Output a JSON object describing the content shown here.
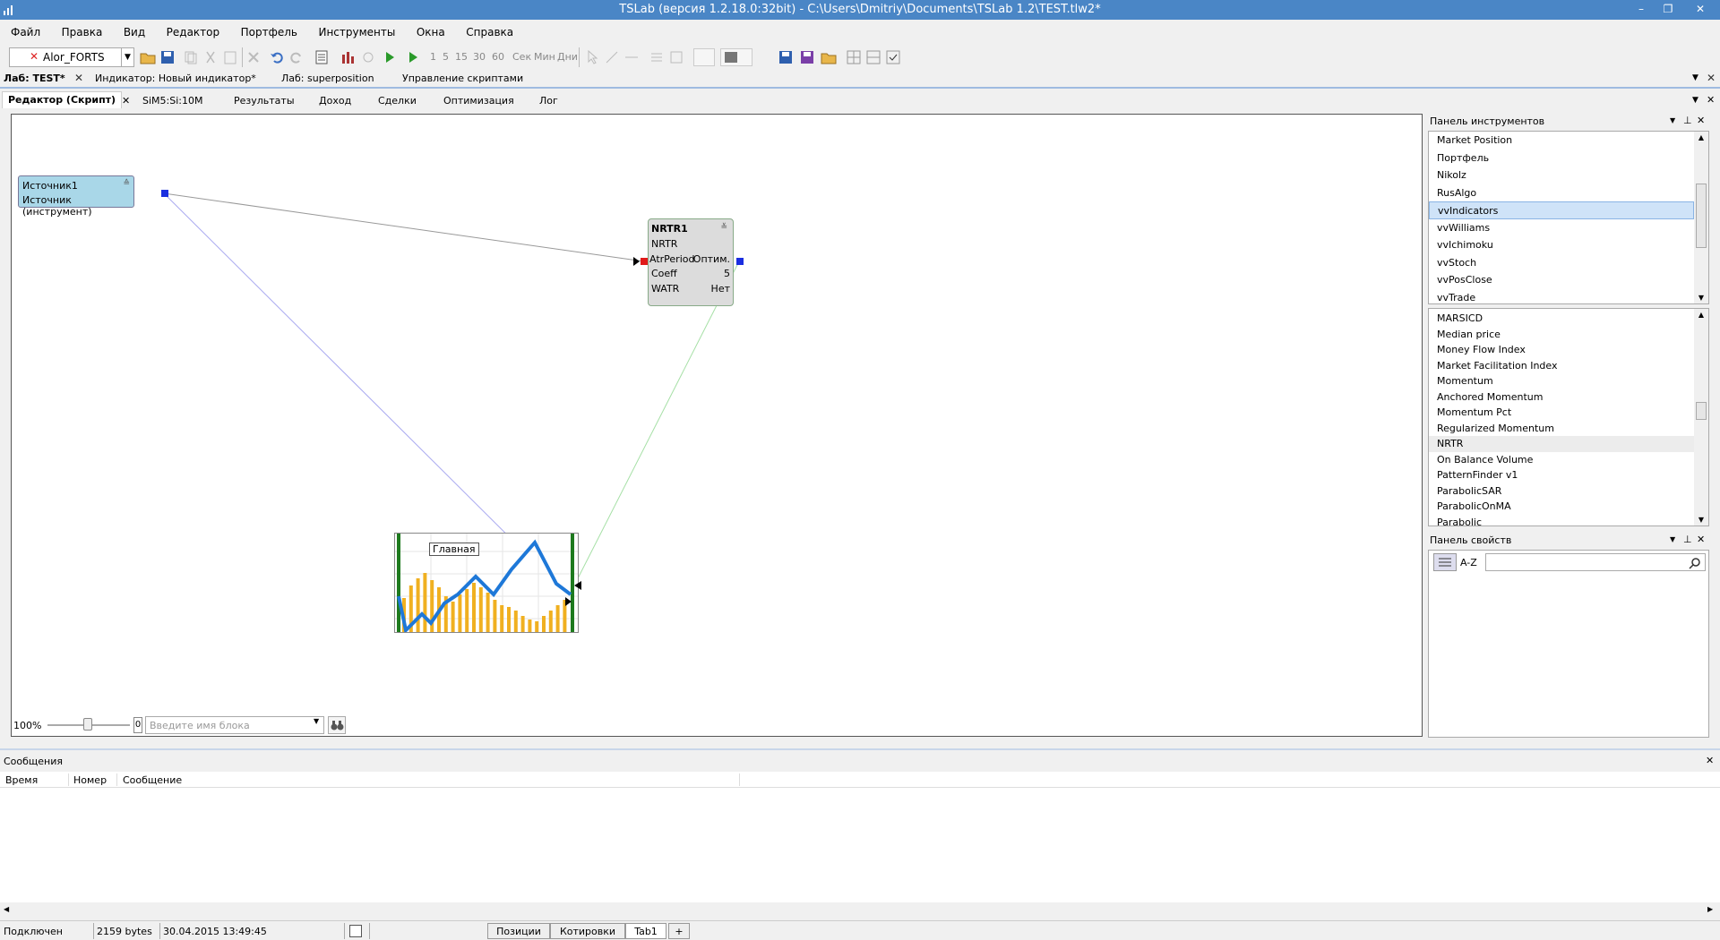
{
  "window": {
    "title": "TSLab (версия 1.2.18.0:32bit) - C:\\Users\\Dmitriy\\Documents\\TSLab 1.2\\TEST.tlw2*",
    "minimize": "–",
    "restore": "❐",
    "close": "✕"
  },
  "menu": [
    "Файл",
    "Правка",
    "Вид",
    "Редактор",
    "Портфель",
    "Инструменты",
    "Окна",
    "Справка"
  ],
  "toolbar": {
    "connection": "Alor_FORTS",
    "intervals": [
      "1",
      "5",
      "15",
      "30",
      "60",
      "Сек",
      "Мин",
      "Дни"
    ]
  },
  "lab_tabs": {
    "lab": "Лаб: TEST*",
    "indicator": "Индикатор: Новый индикатор*",
    "lab2": "Лаб: superposition",
    "scripts": "Управление скриптами"
  },
  "inner_tabs": [
    "Редактор (Скрипт)",
    "SiM5:Si:10M",
    "Результаты",
    "Доход",
    "Сделки",
    "Оптимизация",
    "Лог"
  ],
  "canvas": {
    "source_block": {
      "name": "Источник1",
      "type": "Источник (инструмент)"
    },
    "nrtr_block": {
      "name": "NRTR1",
      "type": "NRTR",
      "params": [
        {
          "name": "AtrPeriod",
          "value": "Оптим."
        },
        {
          "name": "Coeff",
          "value": "5"
        },
        {
          "name": "WATR",
          "value": "Нет"
        }
      ]
    },
    "chart_block": {
      "label": "Главная"
    },
    "zoom": "100%",
    "zoom_zero": "0",
    "search_placeholder": "Введите имя блока"
  },
  "tool_panel": {
    "title": "Панель инструментов",
    "groups": [
      "Market Position",
      "Портфель",
      "Nikolz",
      "RusAlgo",
      "vvIndicators",
      "vvWilliams",
      "vvIchimoku",
      "vvStoch",
      "vvPosClose",
      "vvTrade"
    ],
    "selected_group": "vvIndicators",
    "items": [
      "MARSICD",
      "Median price",
      "Money Flow Index",
      "Market Facilitation Index",
      "Momentum",
      "Anchored Momentum",
      "Momentum Pct",
      "Regularized Momentum",
      "NRTR",
      "On Balance Volume",
      "PatternFinder v1",
      "ParabolicSAR",
      "ParabolicOnMA",
      "Parabolic"
    ],
    "highlighted_item": "NRTR"
  },
  "props_panel": {
    "title": "Панель свойств",
    "sort_az": "A-Z"
  },
  "messages": {
    "title": "Сообщения",
    "columns": [
      "Время",
      "Номер",
      "Сообщение"
    ]
  },
  "status": {
    "connection": "Подключен",
    "size": "2159 bytes",
    "datetime": "30.04.2015 13:49:45",
    "tabs": [
      "Позиции",
      "Котировки",
      "Tab1",
      "+"
    ]
  }
}
